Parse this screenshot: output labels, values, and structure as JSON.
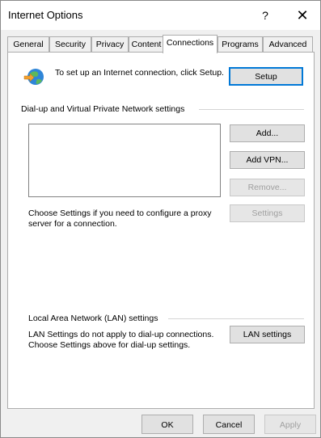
{
  "window": {
    "title": "Internet Options",
    "help_glyph": "?",
    "close_glyph": "✕"
  },
  "tabs": [
    {
      "label": "General"
    },
    {
      "label": "Security"
    },
    {
      "label": "Privacy"
    },
    {
      "label": "Content"
    },
    {
      "label": "Connections",
      "active": true
    },
    {
      "label": "Programs"
    },
    {
      "label": "Advanced"
    }
  ],
  "setup_section": {
    "text": "To set up an Internet connection, click Setup.",
    "button": "Setup",
    "icon": "globe-network-icon"
  },
  "dialup_section": {
    "heading": "Dial-up and Virtual Private Network settings",
    "add_button": "Add...",
    "add_vpn_button": "Add VPN...",
    "remove_button": "Remove...",
    "settings_button": "Settings",
    "proxy_text": "Choose Settings if you need to configure a proxy server for a connection."
  },
  "lan_section": {
    "heading": "Local Area Network (LAN) settings",
    "text": "LAN Settings do not apply to dial-up connections. Choose Settings above for dial-up settings.",
    "button": "LAN settings"
  },
  "footer": {
    "ok": "OK",
    "cancel": "Cancel",
    "apply": "Apply"
  },
  "colors": {
    "accent": "#0078d7",
    "disabled_text": "#a0a0a0"
  }
}
